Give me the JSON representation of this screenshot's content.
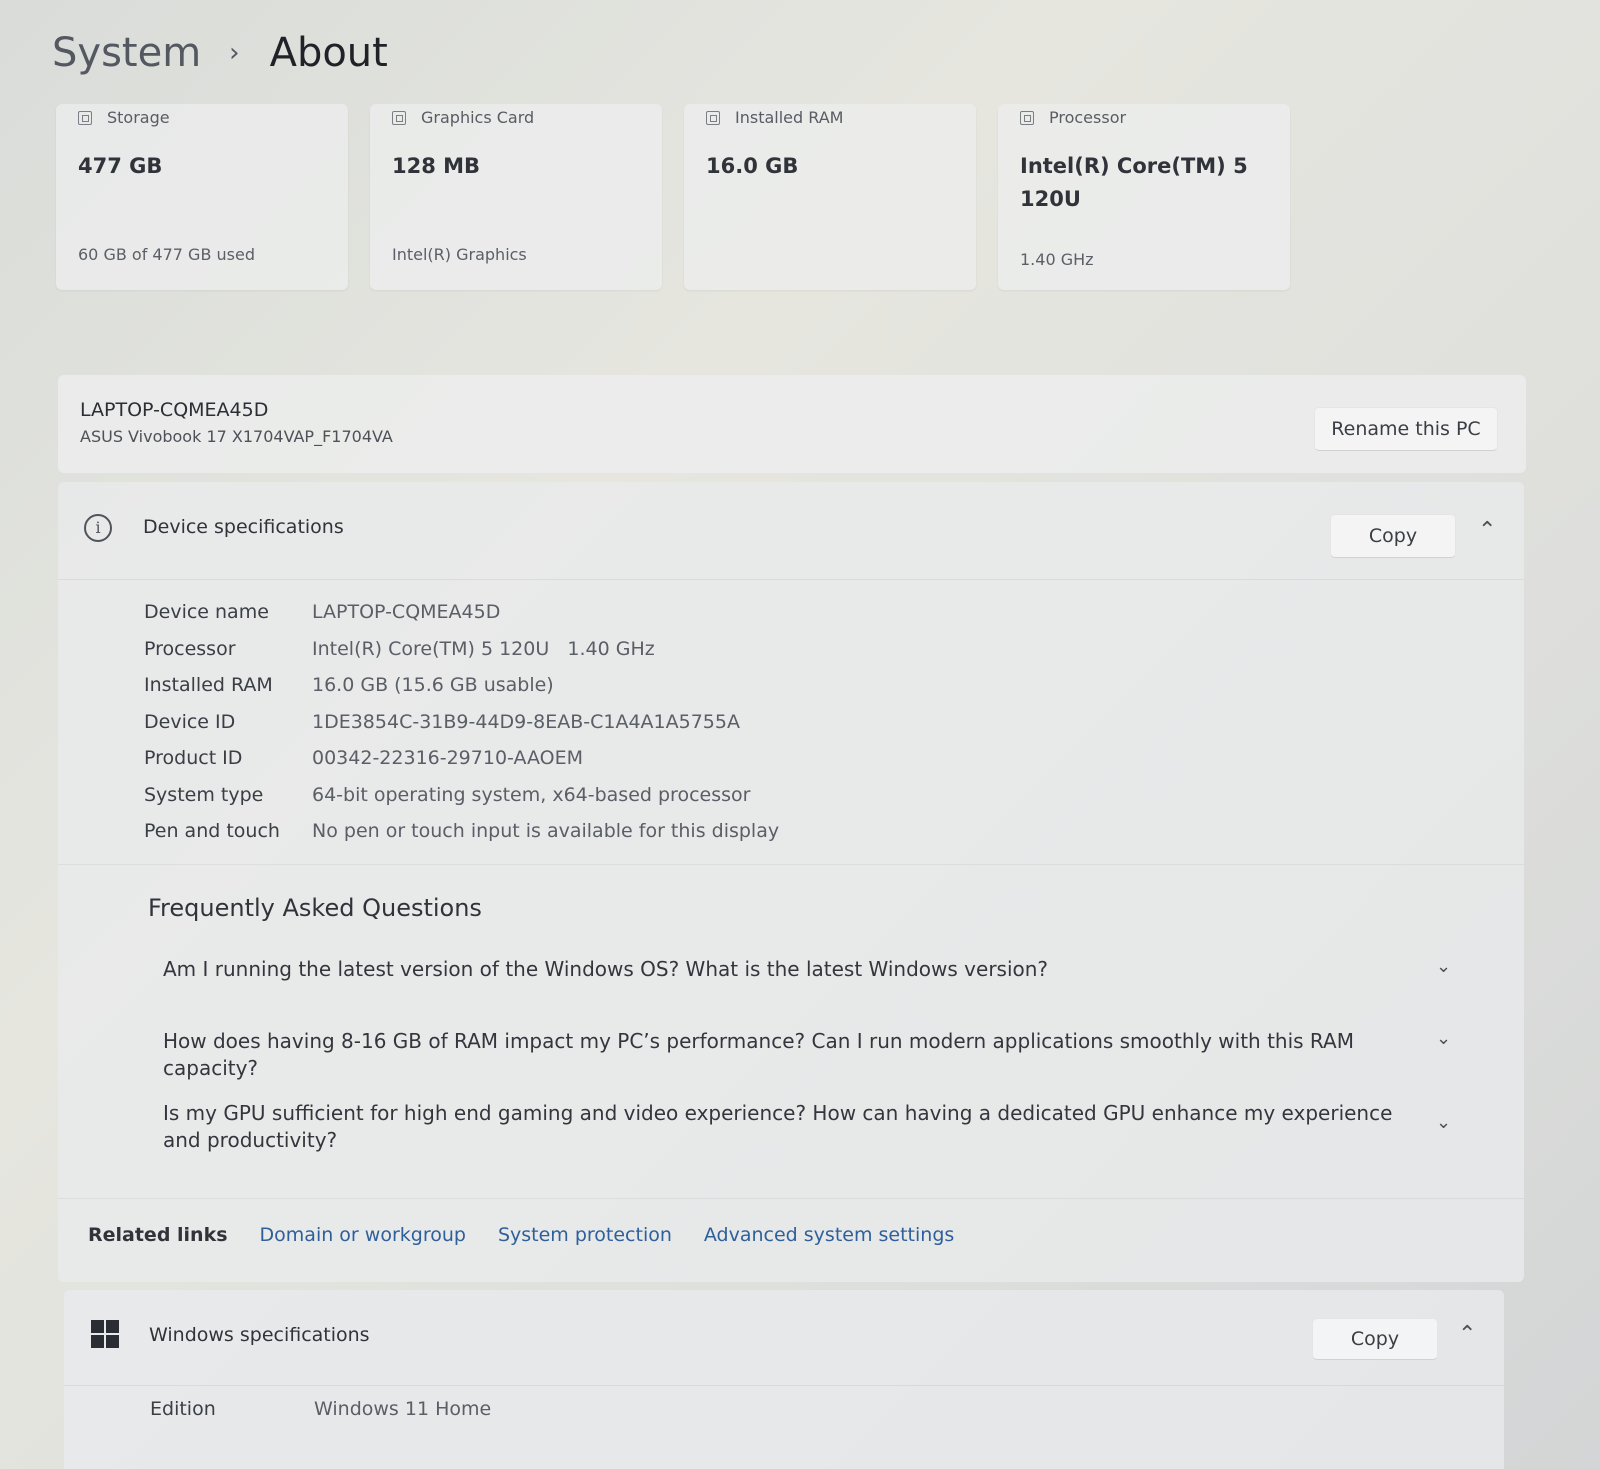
{
  "breadcrumb": {
    "parent": "System",
    "separator": "›",
    "current": "About"
  },
  "cards": [
    {
      "icon": "storage-icon",
      "title": "Storage",
      "value": "477 GB",
      "sub": "60 GB of 477 GB used"
    },
    {
      "icon": "graphics-card-icon",
      "title": "Graphics Card",
      "value": "128 MB",
      "sub": "Intel(R) Graphics"
    },
    {
      "icon": "ram-icon",
      "title": "Installed RAM",
      "value": "16.0 GB",
      "sub": ""
    },
    {
      "icon": "processor-icon",
      "title": "Processor",
      "value": "Intel(R) Core(TM) 5 120U",
      "sub": "1.40 GHz"
    }
  ],
  "pc": {
    "name": "LAPTOP-CQMEA45D",
    "model": "ASUS Vivobook 17 X1704VAP_F1704VA",
    "rename_label": "Rename this PC"
  },
  "device_specs": {
    "title": "Device specifications",
    "copy_label": "Copy",
    "rows": [
      {
        "label": "Device name",
        "value": "LAPTOP-CQMEA45D"
      },
      {
        "label": "Processor",
        "value": "Intel(R) Core(TM) 5 120U   1.40 GHz"
      },
      {
        "label": "Installed RAM",
        "value": "16.0 GB (15.6 GB usable)"
      },
      {
        "label": "Device ID",
        "value": "1DE3854C-31B9-44D9-8EAB-C1A4A1A5755A"
      },
      {
        "label": "Product ID",
        "value": "00342-22316-29710-AAOEM"
      },
      {
        "label": "System type",
        "value": "64-bit operating system, x64-based processor"
      },
      {
        "label": "Pen and touch",
        "value": "No pen or touch input is available for this display"
      }
    ]
  },
  "faq": {
    "title": "Frequently Asked Questions",
    "items": [
      "Am I running the latest version of the Windows OS? What is the latest Windows version?",
      "How does having 8-16 GB of RAM impact my PC’s performance? Can I run modern applications smoothly with this RAM capacity?",
      "Is my GPU sufficient for high end gaming and video experience? How can having a dedicated GPU enhance my experience and productivity?"
    ]
  },
  "related": {
    "label": "Related links",
    "links": [
      "Domain or workgroup",
      "System protection",
      "Advanced system settings"
    ]
  },
  "windows_specs": {
    "title": "Windows specifications",
    "copy_label": "Copy",
    "rows": [
      {
        "label": "Edition",
        "value": "Windows 11 Home"
      }
    ]
  },
  "colors": {
    "link": "#2f5f9b",
    "background": "#e2e3df"
  }
}
